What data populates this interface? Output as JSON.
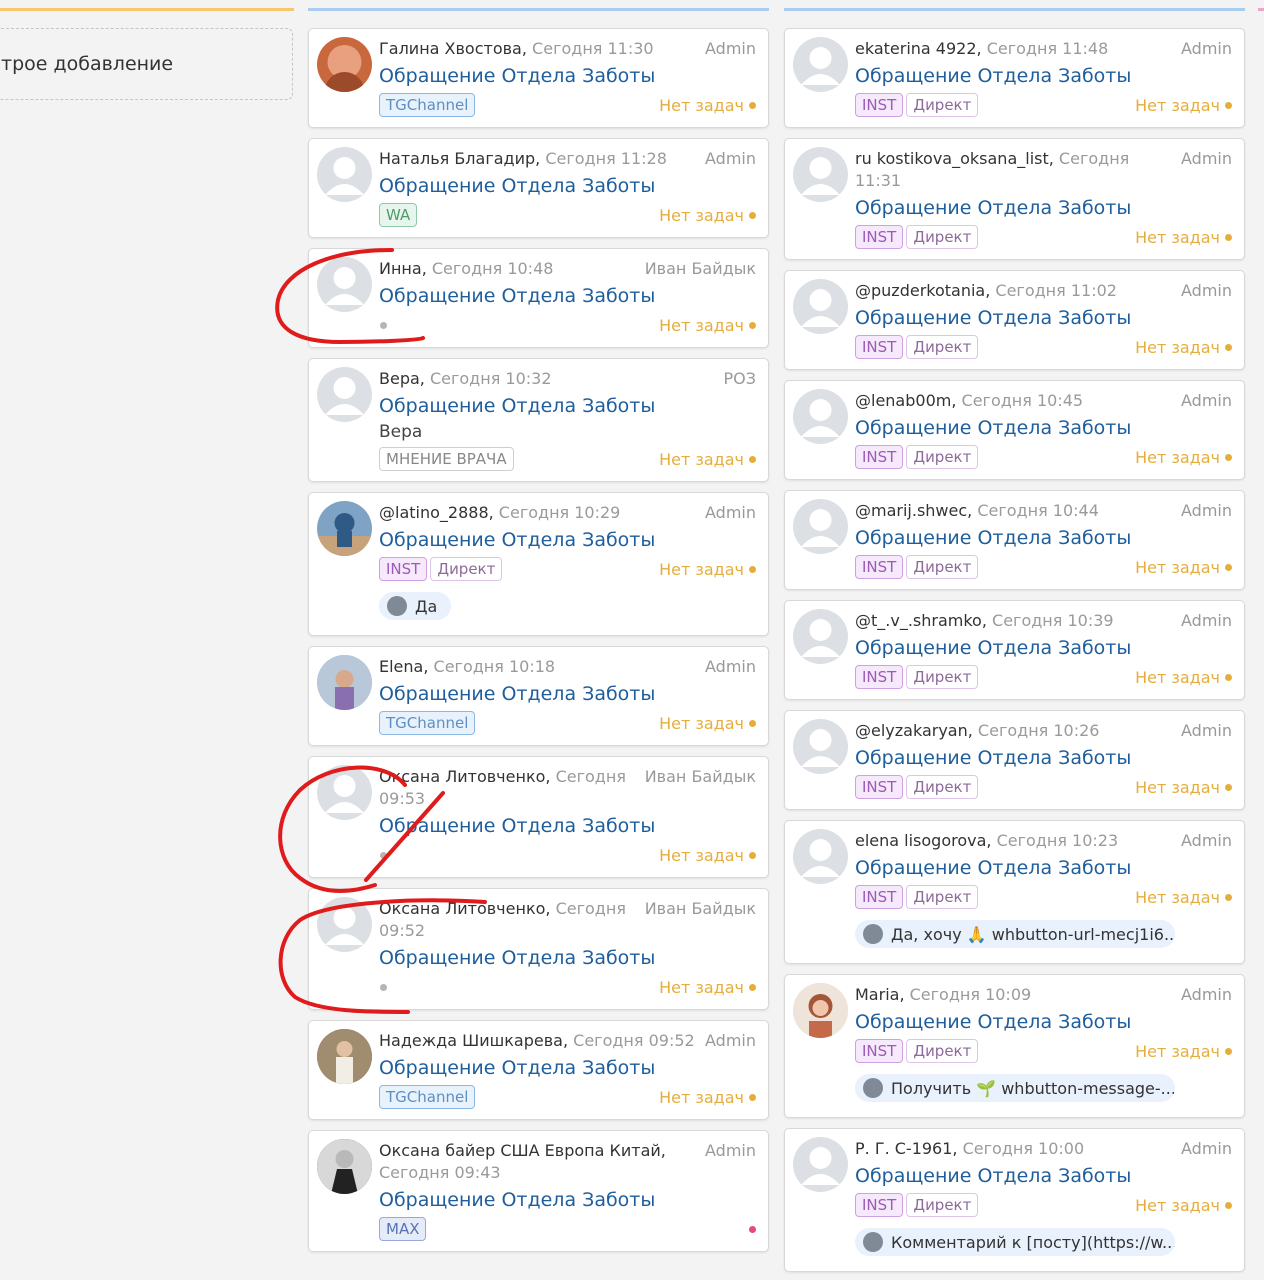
{
  "quick_add": {
    "label": "трое добавление"
  },
  "left_cards": [
    {
      "name": "Галина Хвостова,",
      "date": "Сегодня 11:30",
      "owner": "Admin",
      "title": "Обращение Отдела Заботы",
      "tags": [
        "TGChannel"
      ],
      "status": "Нет задач"
    },
    {
      "name": "Наталья Благадир,",
      "date": "Сегодня 11:28",
      "owner": "Admin",
      "title": "Обращение Отдела Заботы",
      "tags": [
        "WA"
      ],
      "status": "Нет задач"
    },
    {
      "name": "Инна,",
      "date": "Сегодня 10:48",
      "owner": "Иван Байдык",
      "title": "Обращение Отдела Заботы",
      "status": "Нет задач"
    },
    {
      "name": "Вера,",
      "date": "Сегодня 10:32",
      "owner": "РОЗ",
      "title": "Обращение Отдела Заботы",
      "subtext": "Вера",
      "tags": [
        "МНЕНИЕ ВРАЧА"
      ],
      "status": "Нет задач"
    },
    {
      "name": "@latino_2888,",
      "date": "Сегодня 10:29",
      "owner": "Admin",
      "title": "Обращение Отдела Заботы",
      "tags": [
        "INST",
        "Директ"
      ],
      "status": "Нет задач",
      "bubble": "Да"
    },
    {
      "name": "Elena,",
      "date": "Сегодня 10:18",
      "owner": "Admin",
      "title": "Обращение Отдела Заботы",
      "tags": [
        "TGChannel"
      ],
      "status": "Нет задач"
    },
    {
      "name": "Оксана Литовченко,",
      "date": "Сегодня 09:53",
      "owner": "Иван Байдык",
      "title": "Обращение Отдела Заботы",
      "status": "Нет задач"
    },
    {
      "name": "Оксана Литовченко,",
      "date": "Сегодня 09:52",
      "owner": "Иван Байдык",
      "title": "Обращение Отдела Заботы",
      "status": "Нет задач"
    },
    {
      "name": "Надежда Шишкарева,",
      "date": "Сегодня 09:52",
      "owner": "Admin",
      "title": "Обращение Отдела Заботы",
      "tags": [
        "TGChannel"
      ],
      "status": "Нет задач"
    },
    {
      "name": "Оксана байер США Европа Китай,",
      "date": "Сегодня 09:43",
      "owner": "Admin",
      "title": "Обращение Отдела Заботы",
      "tags": [
        "MAX"
      ],
      "status": ""
    }
  ],
  "right_cards": [
    {
      "name": "ekaterina 4922,",
      "date": "Сегодня 11:48",
      "owner": "Admin",
      "title": "Обращение Отдела Заботы",
      "tags": [
        "INST",
        "Директ"
      ],
      "status": "Нет задач"
    },
    {
      "name": "ru kostikova_oksana_list,",
      "date": "Сегодня 11:31",
      "owner": "Admin",
      "title": "Обращение Отдела Заботы",
      "tags": [
        "INST",
        "Директ"
      ],
      "status": "Нет задач"
    },
    {
      "name": "@puzderkotania,",
      "date": "Сегодня 11:02",
      "owner": "Admin",
      "title": "Обращение Отдела Заботы",
      "tags": [
        "INST",
        "Директ"
      ],
      "status": "Нет задач"
    },
    {
      "name": "@lenab00m,",
      "date": "Сегодня 10:45",
      "owner": "Admin",
      "title": "Обращение Отдела Заботы",
      "tags": [
        "INST",
        "Директ"
      ],
      "status": "Нет задач"
    },
    {
      "name": "@marij.shwec,",
      "date": "Сегодня 10:44",
      "owner": "Admin",
      "title": "Обращение Отдела Заботы",
      "tags": [
        "INST",
        "Директ"
      ],
      "status": "Нет задач"
    },
    {
      "name": "@t_.v_.shramko,",
      "date": "Сегодня 10:39",
      "owner": "Admin",
      "title": "Обращение Отдела Заботы",
      "tags": [
        "INST",
        "Директ"
      ],
      "status": "Нет задач"
    },
    {
      "name": "@elyzakaryan,",
      "date": "Сегодня 10:26",
      "owner": "Admin",
      "title": "Обращение Отдела Заботы",
      "tags": [
        "INST",
        "Директ"
      ],
      "status": "Нет задач"
    },
    {
      "name": "elena lisogorova,",
      "date": "Сегодня 10:23",
      "owner": "Admin",
      "title": "Обращение Отдела Заботы",
      "tags": [
        "INST",
        "Директ"
      ],
      "status": "Нет задач",
      "bubble": "Да, хочу 🙏 whbutton-url-mecj1i6..."
    },
    {
      "name": "Maria,",
      "date": "Сегодня 10:09",
      "owner": "Admin",
      "title": "Обращение Отдела Заботы",
      "tags": [
        "INST",
        "Директ"
      ],
      "status": "Нет задач",
      "bubble": "Получить 🌱 whbutton-message-..."
    },
    {
      "name": "Р. Г. С-1961,",
      "date": "Сегодня 10:00",
      "owner": "Admin",
      "title": "Обращение Отдела Заботы",
      "tags": [
        "INST",
        "Директ"
      ],
      "status": "Нет задач",
      "bubble": "Комментарий к [посту](https://w..."
    }
  ],
  "colors": {
    "accent_blue": "#1f5e9c",
    "status_orange": "#e6ad3b",
    "annotation_red": "#e01b1b"
  }
}
